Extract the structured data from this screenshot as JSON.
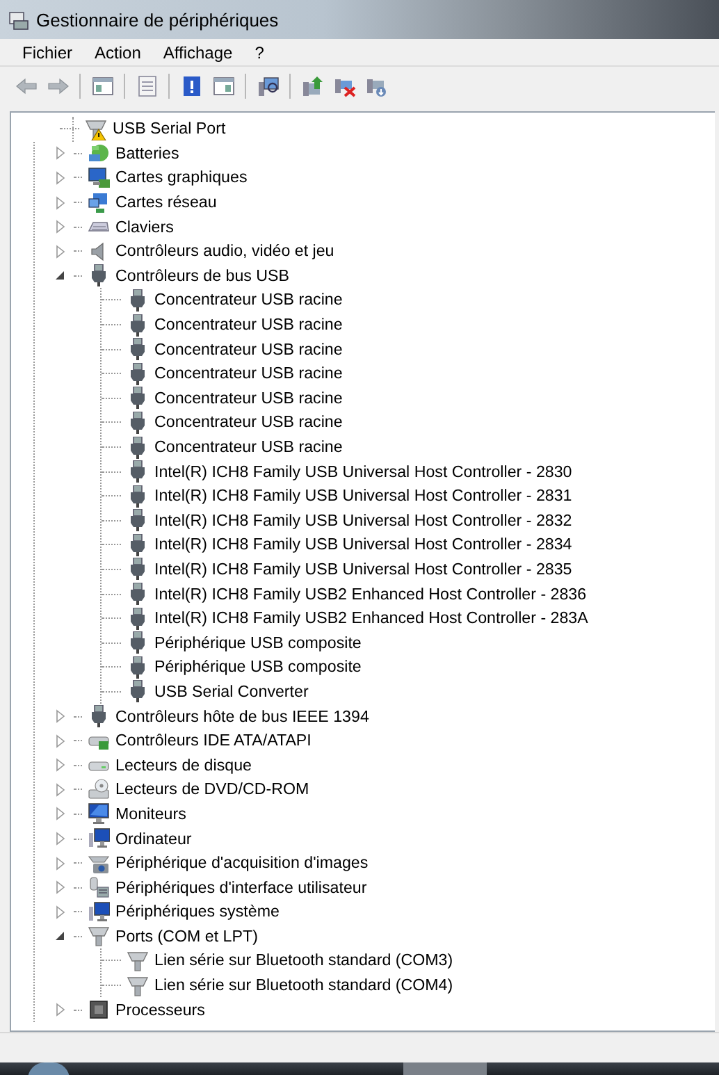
{
  "window": {
    "title": "Gestionnaire de périphériques"
  },
  "menu": [
    "Fichier",
    "Action",
    "Affichage",
    "?"
  ],
  "tree": {
    "continued_children": [
      {
        "label": "USB Serial Port",
        "kind": "port",
        "warning": true
      }
    ],
    "items": [
      {
        "label": "Batteries",
        "kind": "battery",
        "expanded": false
      },
      {
        "label": "Cartes graphiques",
        "kind": "display",
        "expanded": false
      },
      {
        "label": "Cartes réseau",
        "kind": "network",
        "expanded": false
      },
      {
        "label": "Claviers",
        "kind": "keyboard",
        "expanded": false
      },
      {
        "label": "Contrôleurs audio, vidéo et jeu",
        "kind": "speaker",
        "expanded": false
      },
      {
        "label": "Contrôleurs de bus USB",
        "kind": "usb",
        "expanded": true,
        "children": [
          {
            "label": "Concentrateur USB racine",
            "kind": "usb"
          },
          {
            "label": "Concentrateur USB racine",
            "kind": "usb"
          },
          {
            "label": "Concentrateur USB racine",
            "kind": "usb"
          },
          {
            "label": "Concentrateur USB racine",
            "kind": "usb"
          },
          {
            "label": "Concentrateur USB racine",
            "kind": "usb"
          },
          {
            "label": "Concentrateur USB racine",
            "kind": "usb"
          },
          {
            "label": "Concentrateur USB racine",
            "kind": "usb"
          },
          {
            "label": "Intel(R) ICH8 Family USB Universal Host Controller - 2830",
            "kind": "usb"
          },
          {
            "label": "Intel(R) ICH8 Family USB Universal Host Controller - 2831",
            "kind": "usb"
          },
          {
            "label": "Intel(R) ICH8 Family USB Universal Host Controller - 2832",
            "kind": "usb"
          },
          {
            "label": "Intel(R) ICH8 Family USB Universal Host Controller - 2834",
            "kind": "usb"
          },
          {
            "label": "Intel(R) ICH8 Family USB Universal Host Controller - 2835",
            "kind": "usb"
          },
          {
            "label": "Intel(R) ICH8 Family USB2 Enhanced Host Controller - 2836",
            "kind": "usb"
          },
          {
            "label": "Intel(R) ICH8 Family USB2 Enhanced Host Controller - 283A",
            "kind": "usb"
          },
          {
            "label": "Périphérique USB composite",
            "kind": "usb"
          },
          {
            "label": "Périphérique USB composite",
            "kind": "usb"
          },
          {
            "label": "USB Serial Converter",
            "kind": "usb"
          }
        ]
      },
      {
        "label": "Contrôleurs hôte de bus IEEE 1394",
        "kind": "usb",
        "expanded": false
      },
      {
        "label": "Contrôleurs IDE ATA/ATAPI",
        "kind": "ide",
        "expanded": false
      },
      {
        "label": "Lecteurs de disque",
        "kind": "disk",
        "expanded": false
      },
      {
        "label": "Lecteurs de DVD/CD-ROM",
        "kind": "dvd",
        "expanded": false
      },
      {
        "label": "Moniteurs",
        "kind": "monitor",
        "expanded": false
      },
      {
        "label": "Ordinateur",
        "kind": "computer",
        "expanded": false
      },
      {
        "label": "Périphérique d'acquisition d'images",
        "kind": "camera",
        "expanded": false
      },
      {
        "label": "Périphériques d'interface utilisateur",
        "kind": "hid",
        "expanded": false
      },
      {
        "label": "Périphériques système",
        "kind": "computer",
        "expanded": false
      },
      {
        "label": "Ports (COM et LPT)",
        "kind": "port",
        "expanded": true,
        "children": [
          {
            "label": "Lien série sur Bluetooth standard (COM3)",
            "kind": "port"
          },
          {
            "label": "Lien série sur Bluetooth standard (COM4)",
            "kind": "port"
          }
        ]
      },
      {
        "label": "Processeurs",
        "kind": "processor",
        "expanded": false
      }
    ]
  }
}
